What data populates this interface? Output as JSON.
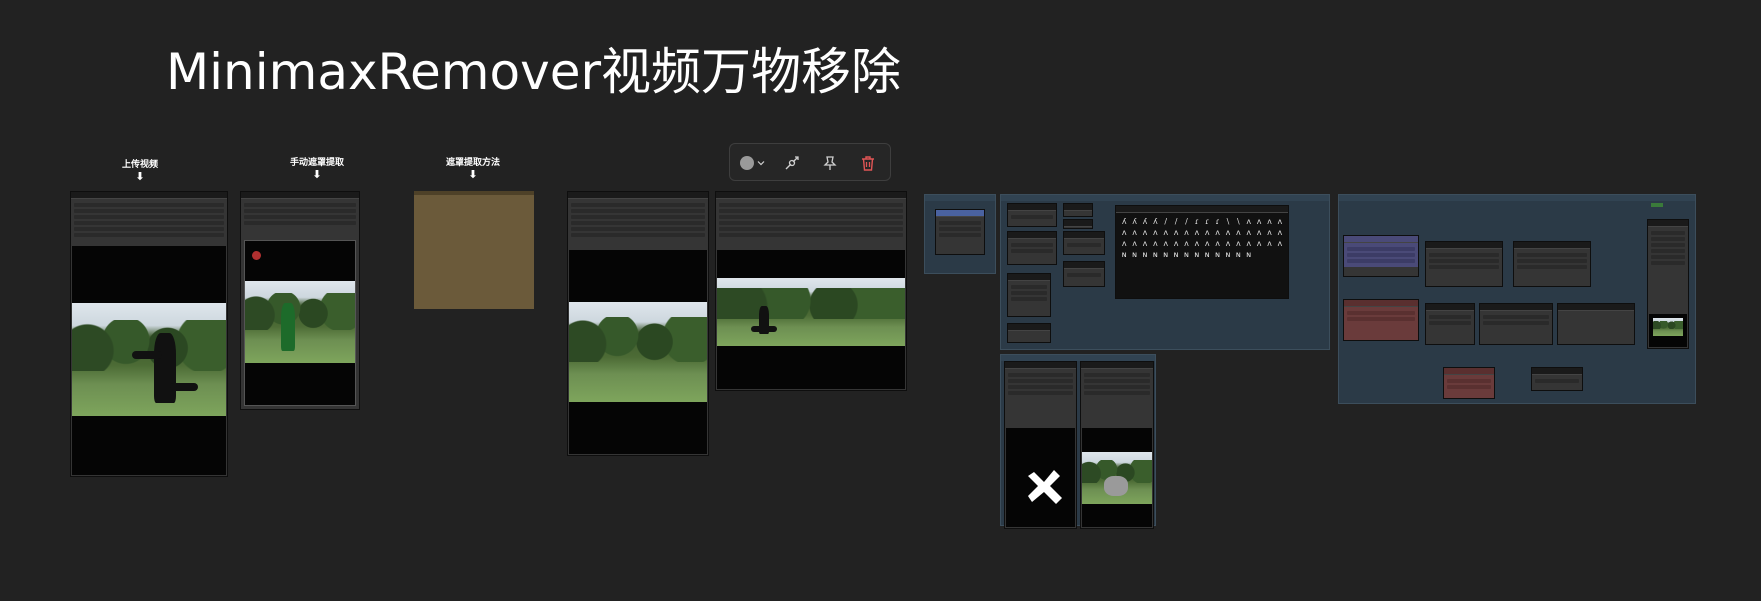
{
  "title": "MinimaxRemover视频万物移除",
  "notes": {
    "upload_video": "上传视频",
    "manual_mask": "手动遮罩提取",
    "mask_method": "遮罩提取方法",
    "arrow": "⬇"
  },
  "toolbar": {
    "color_icon": "color-circle-icon",
    "chevron_icon": "chevron-down-icon",
    "bypass_icon": "bypass-icon",
    "pin_icon": "pin-icon",
    "delete_icon": "trash-icon",
    "colors": {
      "delete": "#e05555",
      "circle": "#9a9a9a"
    }
  },
  "colors": {
    "background": "#222222",
    "node": "#353535",
    "group": "#2b3a47",
    "note_brown": "#6b5a3a",
    "purple_node": "#4a4a78",
    "red_node": "#6a3b3b"
  }
}
